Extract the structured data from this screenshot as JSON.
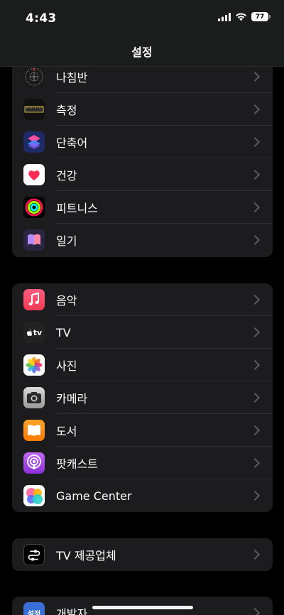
{
  "status_bar": {
    "time": "4:43",
    "battery": "77"
  },
  "header": {
    "title": "설정"
  },
  "groups": [
    {
      "items": [
        {
          "label": "나침반",
          "icon": "compass-icon"
        },
        {
          "label": "측정",
          "icon": "measure-icon"
        },
        {
          "label": "단축어",
          "icon": "shortcuts-icon"
        },
        {
          "label": "건강",
          "icon": "health-icon"
        },
        {
          "label": "피트니스",
          "icon": "fitness-icon"
        },
        {
          "label": "일기",
          "icon": "journal-icon"
        }
      ]
    },
    {
      "items": [
        {
          "label": "음악",
          "icon": "music-icon"
        },
        {
          "label": "TV",
          "icon": "tv-icon"
        },
        {
          "label": "사진",
          "icon": "photos-icon"
        },
        {
          "label": "카메라",
          "icon": "camera-icon"
        },
        {
          "label": "도서",
          "icon": "books-icon"
        },
        {
          "label": "팟캐스트",
          "icon": "podcasts-icon"
        },
        {
          "label": "Game Center",
          "icon": "game-center-icon"
        }
      ]
    },
    {
      "items": [
        {
          "label": "TV 제공업체",
          "icon": "tv-provider-icon"
        }
      ]
    },
    {
      "items": [
        {
          "label": "개발자",
          "icon": "developer-icon"
        }
      ]
    }
  ],
  "icons": {
    "tv_text": "tv",
    "developer_text": "설정"
  },
  "colors": {
    "background": "#000000",
    "cell": "#1c1c1e",
    "header": "#1b1c1c",
    "chevron": "#5b5b5f"
  }
}
